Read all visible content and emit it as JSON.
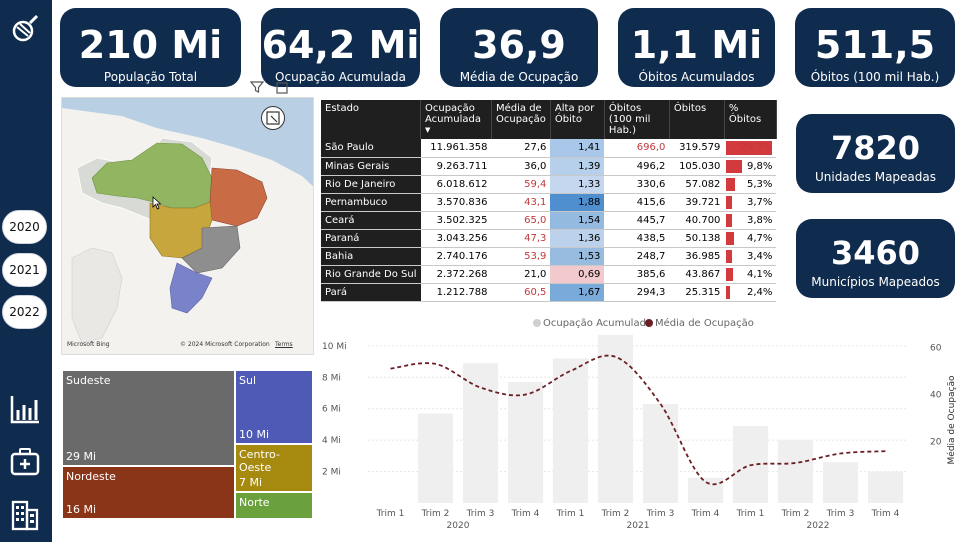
{
  "sidebar": {
    "years": [
      "2020",
      "2021",
      "2022"
    ],
    "icons": [
      "logo-icon",
      "chart-icon",
      "medical-kit-icon",
      "building-icon"
    ]
  },
  "kpis": [
    {
      "value": "210 Mi",
      "label": "População Total"
    },
    {
      "value": "64,2 Mi",
      "label": "Ocupação Acumulada"
    },
    {
      "value": "36,9",
      "label": "Média de Ocupação"
    },
    {
      "value": "1,1 Mi",
      "label": "Óbitos Acumulados"
    },
    {
      "value": "511,5",
      "label": "Óbitos (100 mil Hab.)"
    },
    {
      "value": "7820",
      "label": "Unidades Mapeadas"
    },
    {
      "value": "3460",
      "label": "Municípios Mapeados"
    }
  ],
  "map": {
    "copyright": "© 2024 Microsoft Corporation",
    "terms": "Terms",
    "bing": "Microsoft Bing"
  },
  "table": {
    "headers": [
      "Estado",
      "Ocupação Acumulada",
      "Média de Ocupação",
      "Alta por Óbito",
      "Óbitos (100 mil Hab.)",
      "Óbitos",
      "% Óbitos"
    ],
    "rows": [
      {
        "estado": "São Paulo",
        "ocupacao": "11.961.358",
        "media": "27,6",
        "alta": "1,41",
        "obitos100": "696,0",
        "obitos": "319.579",
        "pct": "29,7%",
        "pct_value": 29.7,
        "alta_color": "#a9c7e8",
        "media_red": false,
        "ob100_red": true
      },
      {
        "estado": "Minas Gerais",
        "ocupacao": "9.263.711",
        "media": "36,0",
        "alta": "1,39",
        "obitos100": "496,2",
        "obitos": "105.030",
        "pct": "9,8%",
        "pct_value": 9.8,
        "alta_color": "#b6cfea",
        "media_red": false,
        "ob100_red": false
      },
      {
        "estado": "Rio De Janeiro",
        "ocupacao": "6.018.612",
        "media": "59,4",
        "alta": "1,33",
        "obitos100": "330,6",
        "obitos": "57.082",
        "pct": "5,3%",
        "pct_value": 5.3,
        "alta_color": "#c4d7ee",
        "media_red": true,
        "ob100_red": false
      },
      {
        "estado": "Pernambuco",
        "ocupacao": "3.570.836",
        "media": "43,1",
        "alta": "1,88",
        "obitos100": "415,6",
        "obitos": "39.721",
        "pct": "3,7%",
        "pct_value": 3.7,
        "alta_color": "#4f8fd0",
        "media_red": true,
        "ob100_red": false
      },
      {
        "estado": "Ceará",
        "ocupacao": "3.502.325",
        "media": "65,0",
        "alta": "1,54",
        "obitos100": "445,7",
        "obitos": "40.700",
        "pct": "3,8%",
        "pct_value": 3.8,
        "alta_color": "#95badf",
        "media_red": true,
        "ob100_red": false
      },
      {
        "estado": "Paraná",
        "ocupacao": "3.043.256",
        "media": "47,3",
        "alta": "1,36",
        "obitos100": "438,5",
        "obitos": "50.138",
        "pct": "4,7%",
        "pct_value": 4.7,
        "alta_color": "#bcd2ec",
        "media_red": true,
        "ob100_red": false
      },
      {
        "estado": "Bahia",
        "ocupacao": "2.740.176",
        "media": "53,9",
        "alta": "1,53",
        "obitos100": "248,7",
        "obitos": "36.985",
        "pct": "3,4%",
        "pct_value": 3.4,
        "alta_color": "#98bce0",
        "media_red": true,
        "ob100_red": false
      },
      {
        "estado": "Rio Grande Do Sul",
        "ocupacao": "2.372.268",
        "media": "21,0",
        "alta": "0,69",
        "obitos100": "385,6",
        "obitos": "43.867",
        "pct": "4,1%",
        "pct_value": 4.1,
        "alta_color": "#f2c9cc",
        "media_red": false,
        "ob100_red": false
      },
      {
        "estado": "Pará",
        "ocupacao": "1.212.788",
        "media": "60,5",
        "alta": "1,67",
        "obitos100": "294,3",
        "obitos": "25.315",
        "pct": "2,4%",
        "pct_value": 2.4,
        "alta_color": "#7aaad9",
        "media_red": true,
        "ob100_red": false
      }
    ]
  },
  "treemap": [
    {
      "name": "Sudeste",
      "value": "29 Mi",
      "color": "#6a6a6a"
    },
    {
      "name": "Nordeste",
      "value": "16 Mi",
      "color": "#8a3418"
    },
    {
      "name": "Sul",
      "value": "10 Mi",
      "color": "#4e5ab5"
    },
    {
      "name": "Centro-Oeste",
      "value": "7 Mi",
      "color": "#a6890f"
    },
    {
      "name": "Norte",
      "value": "",
      "color": "#6aa13c"
    }
  ],
  "chart_data": {
    "type": "bar",
    "legend": [
      "Ocupação Acumulada",
      "Média de Ocupação"
    ],
    "legend_colors": [
      "#cfcfcf",
      "#6b1f24"
    ],
    "categories": [
      "Trim 1",
      "Trim 2",
      "Trim 3",
      "Trim 4",
      "Trim 1",
      "Trim 2",
      "Trim 3",
      "Trim 4",
      "Trim 1",
      "Trim 2",
      "Trim 3",
      "Trim 4"
    ],
    "years": [
      "2020",
      "2021",
      "2022"
    ],
    "series": [
      {
        "name": "Ocupação Acumulada",
        "type": "bar",
        "axis": "left",
        "values": [
          0,
          5.7,
          8.9,
          7.7,
          9.2,
          10.7,
          6.3,
          1.6,
          4.9,
          4.0,
          2.6,
          2.0
        ]
      },
      {
        "name": "Média de Ocupação",
        "type": "line",
        "axis": "right",
        "values": [
          51,
          53,
          43,
          40,
          50,
          56,
          36,
          3,
          10,
          11,
          15,
          16
        ]
      }
    ],
    "y_left_ticks": [
      "2 Mi",
      "4 Mi",
      "6 Mi",
      "8 Mi",
      "10 Mi"
    ],
    "y_left_lim": [
      0,
      10.5
    ],
    "y_right_ticks": [
      "20",
      "40",
      "60"
    ],
    "y_right_lim": [
      -6,
      64
    ],
    "ylabel_right": "Média de Ocupação"
  }
}
